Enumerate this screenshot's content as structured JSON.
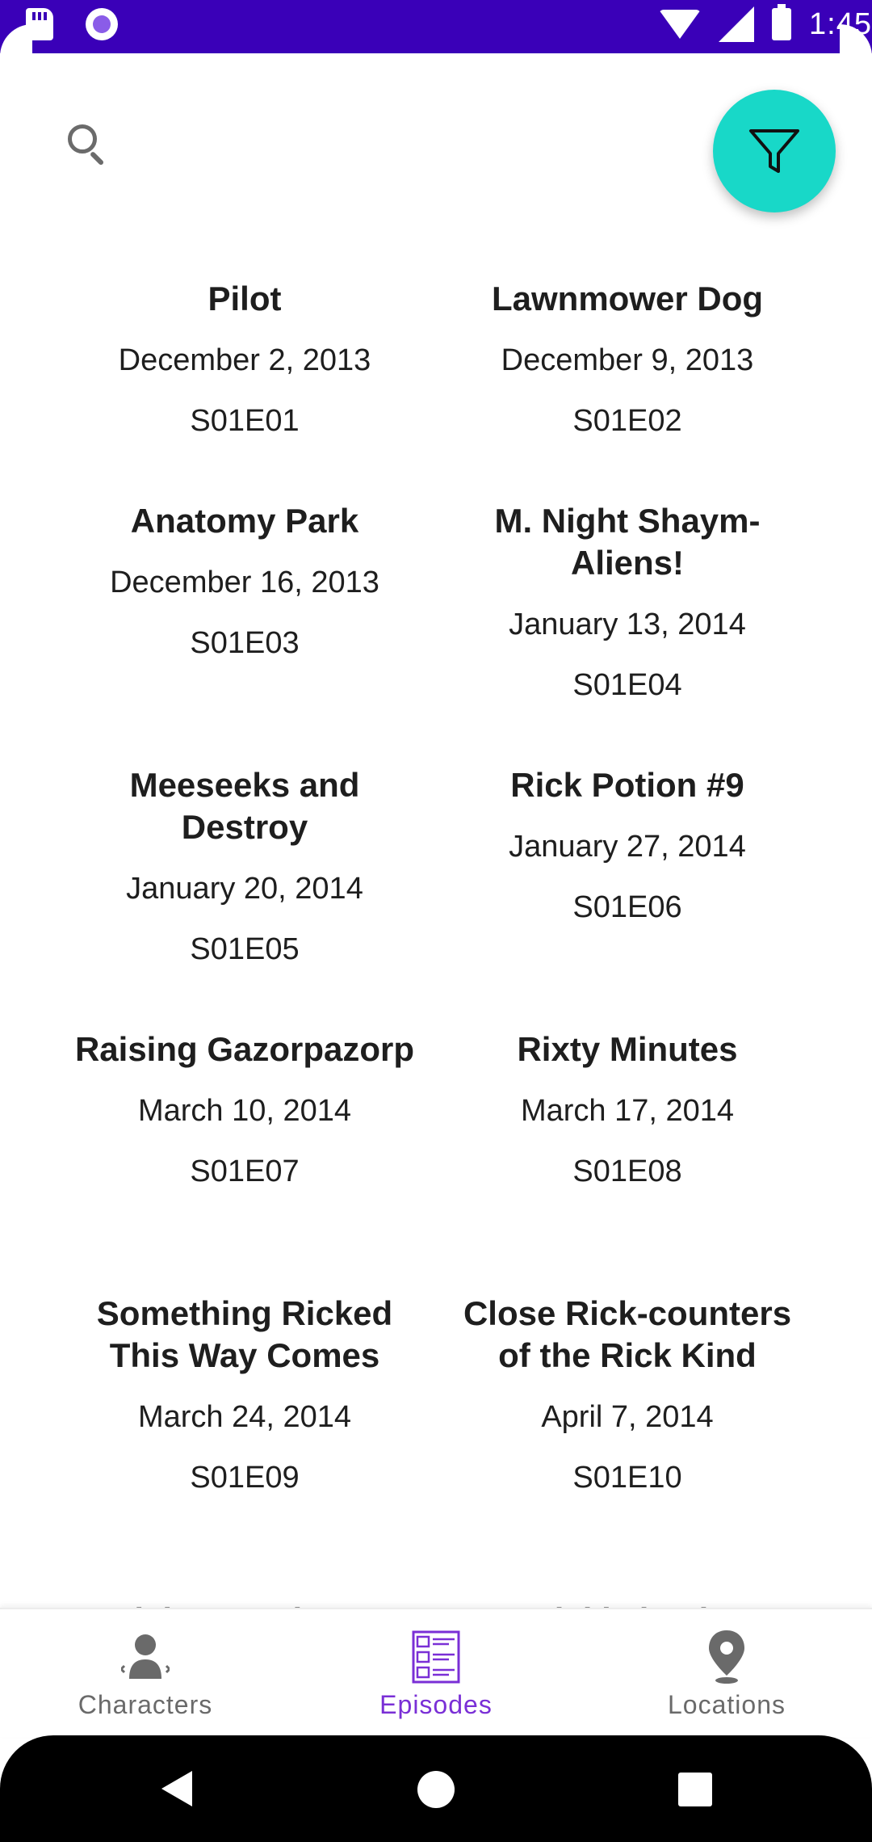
{
  "status_bar": {
    "time": "1:45",
    "icons": [
      "sd-card-icon",
      "recording-icon",
      "wifi-icon",
      "signal-icon",
      "battery-icon"
    ]
  },
  "top": {
    "search_icon": "search-icon",
    "filter_icon": "filter-icon",
    "fab_color": "#18d8c8"
  },
  "episodes": [
    {
      "title": "Pilot",
      "date": "December 2, 2013",
      "code": "S01E01"
    },
    {
      "title": "Lawnmower Dog",
      "date": "December 9, 2013",
      "code": "S01E02"
    },
    {
      "title": "Anatomy Park",
      "date": "December 16, 2013",
      "code": "S01E03"
    },
    {
      "title": "M. Night Shaym-Aliens!",
      "date": "January 13, 2014",
      "code": "S01E04"
    },
    {
      "title": "Meeseeks and Destroy",
      "date": "January 20, 2014",
      "code": "S01E05"
    },
    {
      "title": "Rick Potion #9",
      "date": "January 27, 2014",
      "code": "S01E06"
    },
    {
      "title": "Raising Gazorpazorp",
      "date": "March 10, 2014",
      "code": "S01E07"
    },
    {
      "title": "Rixty Minutes",
      "date": "March 17, 2014",
      "code": "S01E08"
    },
    {
      "title": "Something Ricked This Way Comes",
      "date": "March 24, 2014",
      "code": "S01E09"
    },
    {
      "title": "Close Rick-counters of the Rick Kind",
      "date": "April 7, 2014",
      "code": "S01E10"
    },
    {
      "title": "Ricksy Business",
      "date": "",
      "code": ""
    },
    {
      "title": "A Rickle in Time",
      "date": "",
      "code": ""
    }
  ],
  "bottom_nav": {
    "items": [
      {
        "label": "Characters",
        "icon": "person-icon",
        "active": false
      },
      {
        "label": "Episodes",
        "icon": "episodes-list-icon",
        "active": true
      },
      {
        "label": "Locations",
        "icon": "location-pin-icon",
        "active": false
      }
    ],
    "active_color": "#7a2fd6",
    "inactive_color": "#6a6a6a"
  },
  "system_nav": {
    "buttons": [
      "back-icon",
      "home-icon",
      "recents-icon"
    ]
  }
}
